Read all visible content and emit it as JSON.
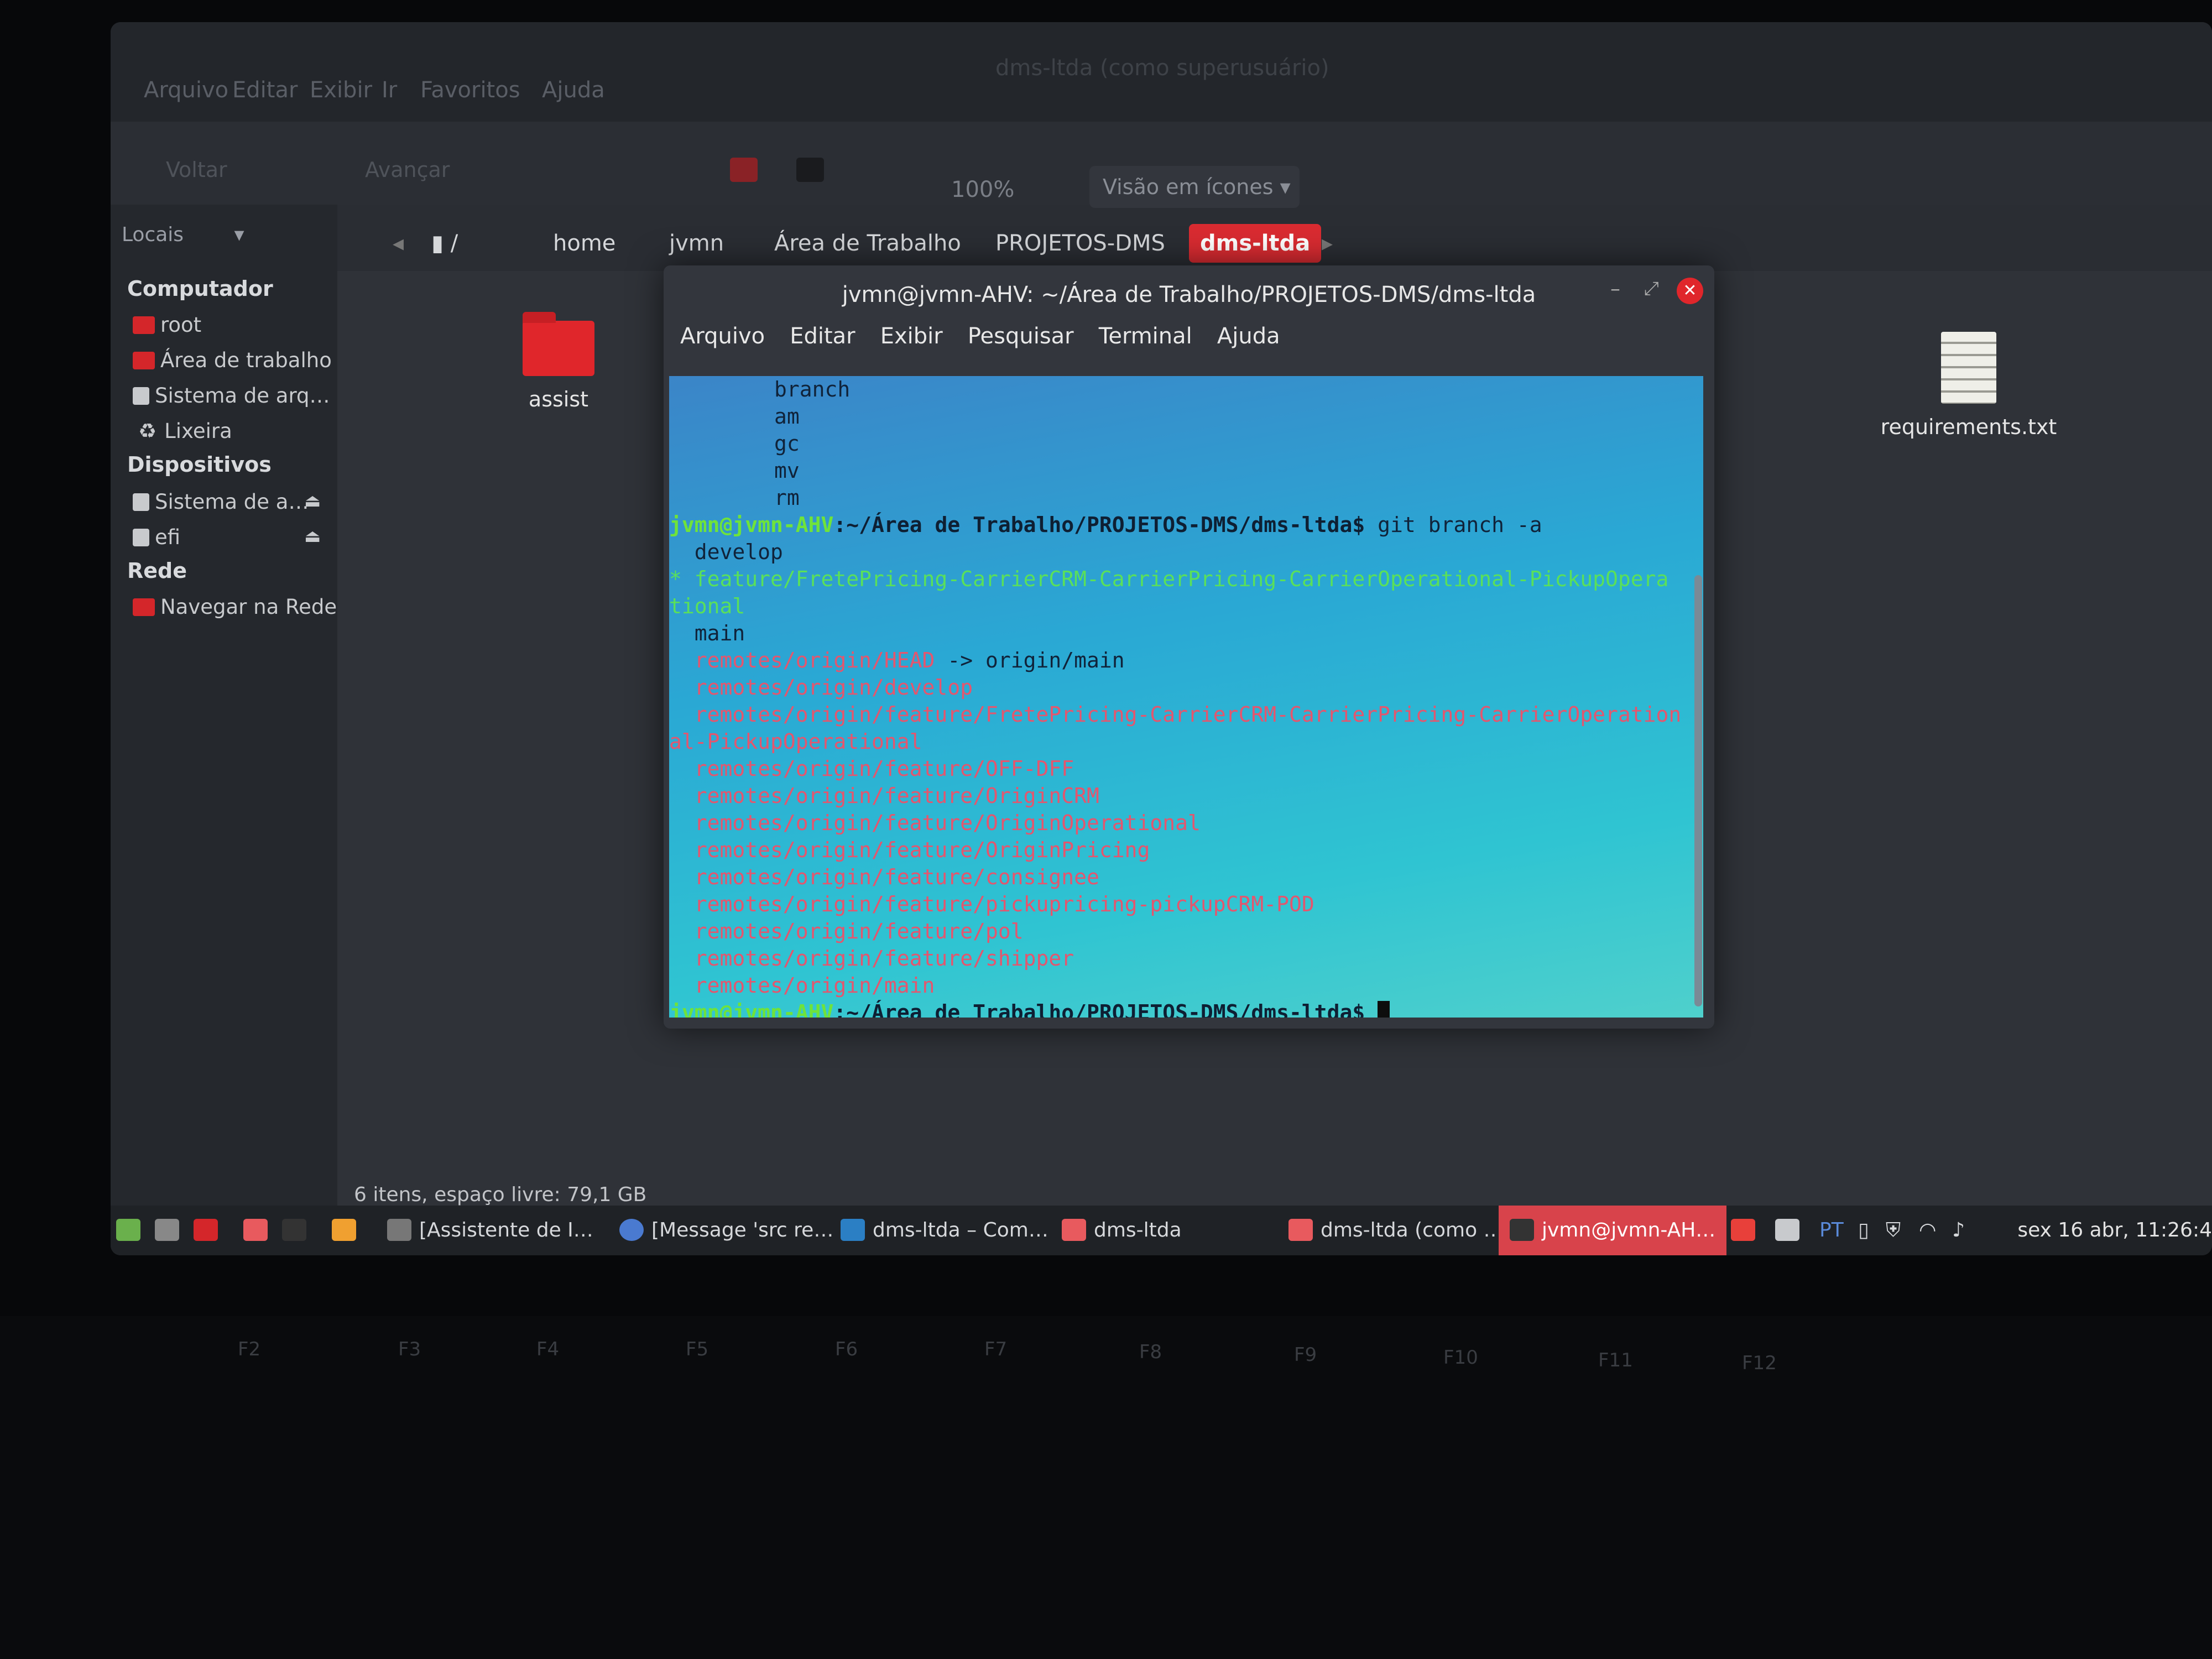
{
  "filemanager": {
    "window_title": "dms-ltda (como superusuário)",
    "menu": [
      "Arquivo",
      "Editar",
      "Exibir",
      "Ir",
      "Favoritos",
      "Ajuda"
    ],
    "toolbar": {
      "back": "Voltar",
      "forward": "Avançar",
      "zoom": "100%",
      "view": "Visão em ícones"
    },
    "places_label": "Locais",
    "sidebar": {
      "computer_header": "Computador",
      "computer_items": [
        "root",
        "Área de trabalho",
        "Sistema de arq…",
        "Lixeira"
      ],
      "devices_header": "Dispositivos",
      "device_items": [
        "Sistema de a…",
        "efi"
      ],
      "network_header": "Rede",
      "network_items": [
        "Navegar na Rede"
      ]
    },
    "breadcrumb": [
      "/",
      "home",
      "jvmn",
      "Área de Trabalho",
      "PROJETOS-DMS",
      "dms-ltda"
    ],
    "files": [
      "assist",
      "requirements.txt"
    ],
    "status": "6 itens, espaço livre: 79,1 GB"
  },
  "terminal": {
    "title": "jvmn@jvmn-AHV: ~/Área de Trabalho/PROJETOS-DMS/dms-ltda",
    "menu": [
      "Arquivo",
      "Editar",
      "Exibir",
      "Pesquisar",
      "Terminal",
      "Ajuda"
    ],
    "pre_lines": [
      "branch",
      "am",
      "gc",
      "mv",
      "rm"
    ],
    "prompt_user": "jvmn@jvmn-AHV",
    "prompt_path": ":~/Área de Trabalho/PROJETOS-DMS/dms-ltda$",
    "command": " git branch -a",
    "branch_develop": "  develop",
    "current_branch_a": "* feature/FretePricing-CarrierCRM-CarrierPricing-CarrierOperational-PickupOpera",
    "current_branch_b": "tional",
    "branch_main": "  main",
    "remote_head": "  remotes/origin/HEAD",
    "remote_head_target": " -> origin/main",
    "remotes": [
      "  remotes/origin/develop",
      "  remotes/origin/feature/FretePricing-CarrierCRM-CarrierPricing-CarrierOperation",
      "al-PickupOperational",
      "  remotes/origin/feature/OFF-DFF",
      "  remotes/origin/feature/OriginCRM",
      "  remotes/origin/feature/OriginOperational",
      "  remotes/origin/feature/OriginPricing",
      "  remotes/origin/feature/consignee",
      "  remotes/origin/feature/pickupricing-pickupCRM-POD",
      "  remotes/origin/feature/pol",
      "  remotes/origin/feature/shipper",
      "  remotes/origin/main"
    ]
  },
  "taskbar": {
    "items": [
      "[Assistente de I…",
      "[Message 'src re…",
      "dms-ltda – Com…",
      "dms-ltda",
      "dms-ltda (como …",
      "jvmn@jvmn-AH…"
    ],
    "lang": "PT",
    "clock": "sex 16 abr, 11:26:4"
  },
  "keyboard": {
    "keys": [
      "F2",
      "F3",
      "F4",
      "F5",
      "F6",
      "F7",
      "F8",
      "F9",
      "F10",
      "F11",
      "F12"
    ]
  },
  "colors": {
    "accent": "#d92b31",
    "terminal_bg": "#2fb8d2",
    "prompt": "#6fe33a",
    "remote": "#e4566e"
  }
}
